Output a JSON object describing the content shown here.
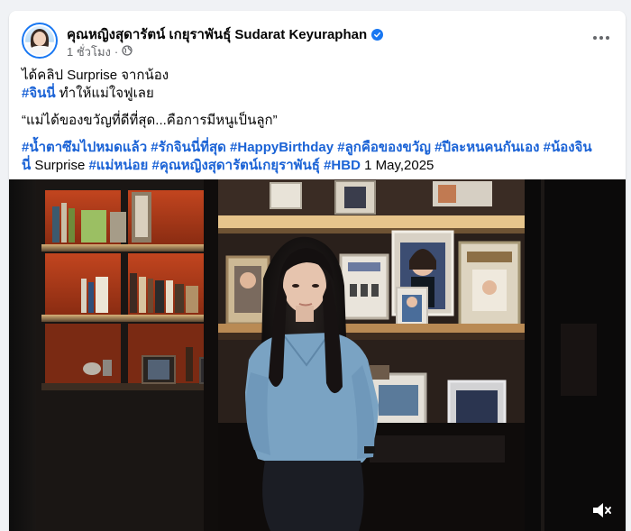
{
  "post": {
    "author": "คุณหญิงสุดารัตน์ เกยุราพันธุ์ Sudarat Keyuraphan",
    "time": "1 ชั่วโมง",
    "dot": "·",
    "audience_icon": "globe-icon",
    "more_icon": "more-options-icon",
    "line1": "ได้คลิป Surprise จากน้อง",
    "line2_tag": "#จินนี่",
    "line2_text": " ทำให้แม่ใจฟูเลย",
    "quote": "“แม่ได้ของขวัญที่ดีที่สุด...คือการมีหนูเป็นลูก”",
    "tags": {
      "t1": "#น้ำตาซึมไปหมดแล้ว",
      "t2": "#รักจินนี่ที่สุด",
      "t3": "#HappyBirthday",
      "t4": "#ลูกคือของขวัญ",
      "t5": "#ปีละหนคนกันเอง",
      "t6a": "#น้องจิน",
      "t6b": "นี่",
      "mid": " Surprise ",
      "t7": "#แม่หน่อย",
      "t8": "#คุณหญิงสุดารัตน์เกยุราพันธุ์",
      "t9": "#HBD",
      "date": " 1 May,2025"
    }
  },
  "video": {
    "mute_icon": "speaker-muted-icon"
  },
  "colors": {
    "hashtag": "#1b63d6",
    "verified": "#1877f2",
    "meta_text": "#65676b",
    "background": "#f0f2f5"
  }
}
